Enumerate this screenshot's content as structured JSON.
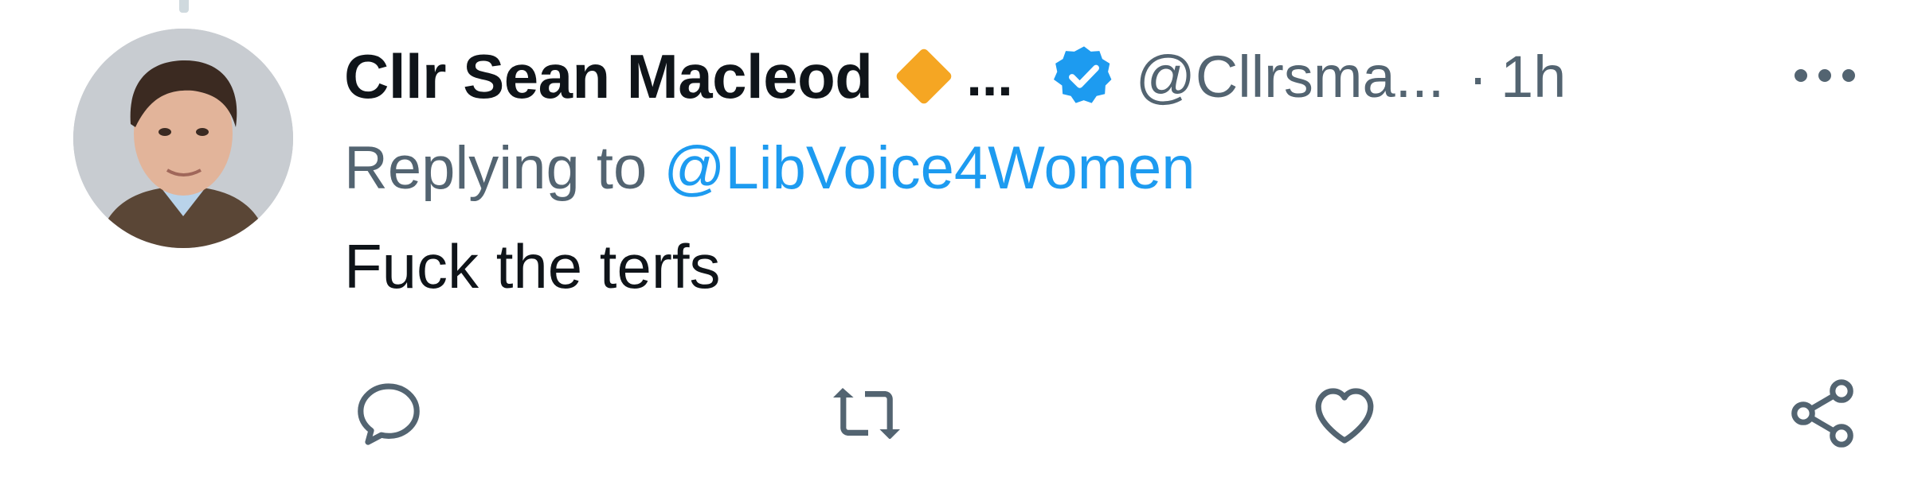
{
  "tweet": {
    "author_name": "Cllr Sean Macleod",
    "name_ellipsis": "...",
    "handle": "@Cllrsma...",
    "separator": "·",
    "timestamp": "1h",
    "reply_prefix": "Replying to ",
    "reply_mention": "@LibVoice4Women",
    "text": "Fuck the terfs"
  },
  "icons": {
    "affiliation": "orange-diamond-icon",
    "verified": "verified-badge-icon",
    "more": "more-options-icon",
    "actions": [
      "reply-icon",
      "retweet-icon",
      "like-icon",
      "share-icon"
    ]
  },
  "colors": {
    "text_primary": "#0f1419",
    "text_secondary": "#536471",
    "link_blue": "#1d9bf0",
    "affiliation_orange": "#f5a623"
  }
}
